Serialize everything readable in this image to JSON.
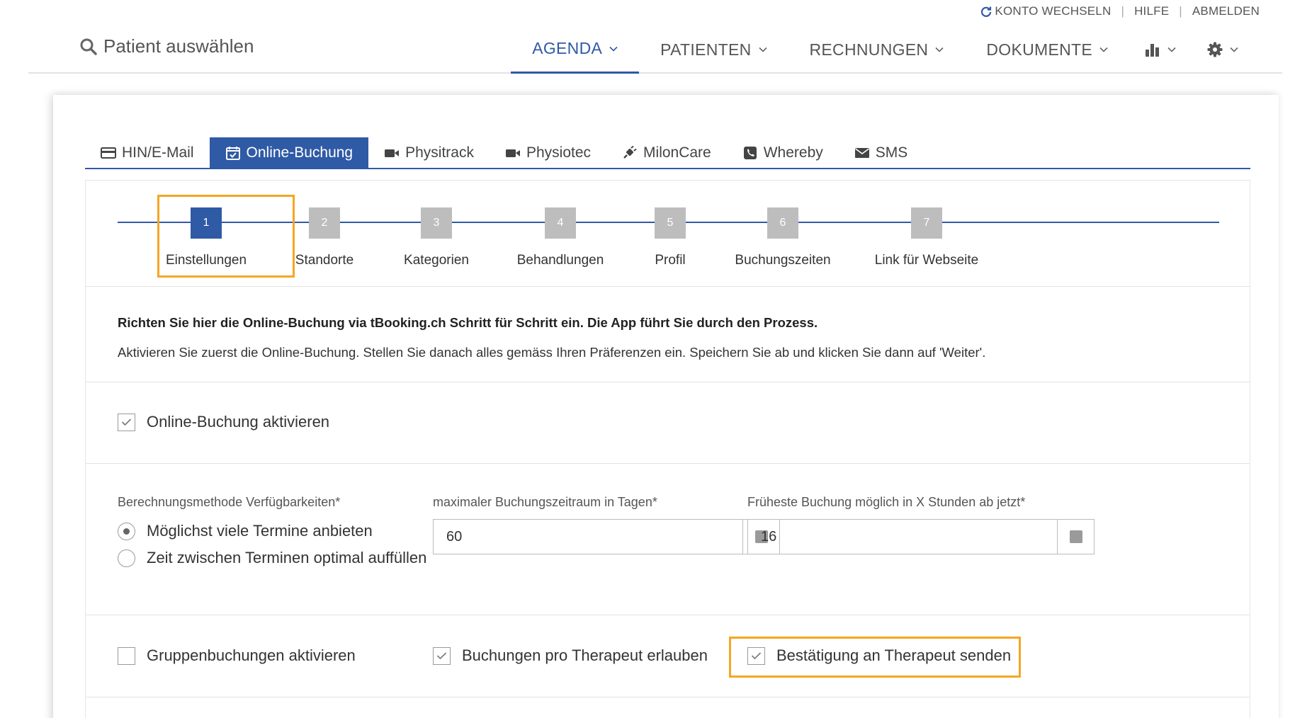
{
  "utility": {
    "switch_account": "KONTO WECHSELN",
    "help": "HILFE",
    "logout": "ABMELDEN"
  },
  "header": {
    "patient_search": "Patient auswählen",
    "nav": [
      "AGENDA",
      "PATIENTEN",
      "RECHNUNGEN",
      "DOKUMENTE"
    ]
  },
  "tabs": [
    "HIN/E-Mail",
    "Online-Buchung",
    "Physitrack",
    "Physiotec",
    "MilonCare",
    "Whereby",
    "SMS"
  ],
  "wizard": {
    "steps": [
      {
        "num": "1",
        "label": "Einstellungen"
      },
      {
        "num": "2",
        "label": "Standorte"
      },
      {
        "num": "3",
        "label": "Kategorien"
      },
      {
        "num": "4",
        "label": "Behandlungen"
      },
      {
        "num": "5",
        "label": "Profil"
      },
      {
        "num": "6",
        "label": "Buchungszeiten"
      },
      {
        "num": "7",
        "label": "Link für Webseite"
      }
    ]
  },
  "intro": {
    "bold": "Richten Sie hier die Online-Buchung via tBooking.ch Schritt für Schritt ein. Die App führt Sie durch den Prozess.",
    "normal": "Aktivieren Sie zuerst die Online-Buchung. Stellen Sie danach alles gemäss Ihren Präferenzen ein. Speichern Sie ab und klicken Sie dann auf 'Weiter'."
  },
  "activate": {
    "label": "Online-Buchung aktivieren",
    "checked": true
  },
  "settings": {
    "method_label": "Berechnungsmethode Verfügbarkeiten*",
    "method_options": [
      "Möglichst viele Termine anbieten",
      "Zeit zwischen Terminen optimal auffüllen"
    ],
    "max_days_label": "maximaler Buchungszeitraum in Tagen*",
    "max_days_value": "60",
    "earliest_label": "Früheste Buchung möglich in X Stunden ab jetzt*",
    "earliest_value": "16"
  },
  "options": {
    "group": "Gruppenbuchungen aktivieren",
    "per_therapist": "Buchungen pro Therapeut erlauben",
    "confirmation": "Bestätigung an Therapeut senden"
  },
  "colors": {
    "accent": "#2f5aa5",
    "highlight": "#f5a623"
  }
}
